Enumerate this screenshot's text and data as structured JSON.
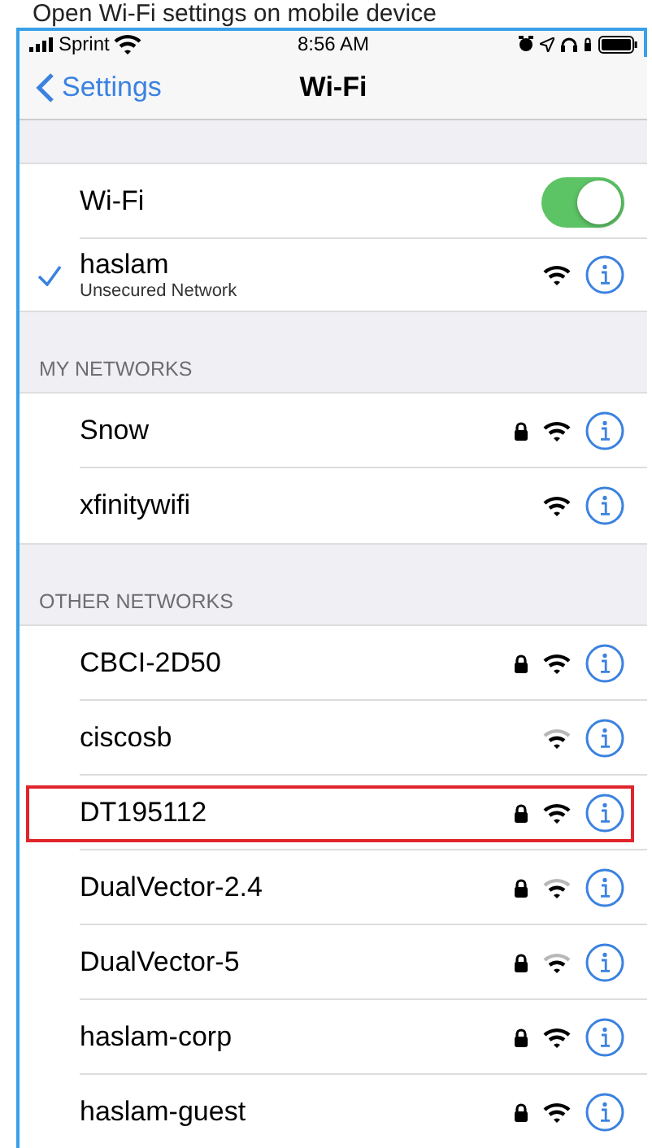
{
  "caption": "Open Wi-Fi settings on mobile device",
  "status_bar": {
    "carrier": "Sprint",
    "time": "8:56 AM"
  },
  "nav": {
    "back": "Settings",
    "title": "Wi-Fi"
  },
  "wifi_toggle": {
    "label": "Wi-Fi",
    "on": true
  },
  "current_network": {
    "name": "haslam",
    "subtitle": "Unsecured Network",
    "connected": true,
    "locked": false,
    "weak_signal": false
  },
  "sections": [
    {
      "header": "MY NETWORKS",
      "networks": [
        {
          "name": "Snow",
          "locked": true,
          "weak_signal": false,
          "highlighted": false
        },
        {
          "name": "xfinitywifi",
          "locked": false,
          "weak_signal": false,
          "highlighted": false
        }
      ]
    },
    {
      "header": "OTHER NETWORKS",
      "networks": [
        {
          "name": "CBCI-2D50",
          "locked": true,
          "weak_signal": false,
          "highlighted": false
        },
        {
          "name": "ciscosb",
          "locked": false,
          "weak_signal": true,
          "highlighted": false
        },
        {
          "name": "DT195112",
          "locked": true,
          "weak_signal": false,
          "highlighted": true
        },
        {
          "name": "DualVector-2.4",
          "locked": true,
          "weak_signal": true,
          "highlighted": false
        },
        {
          "name": "DualVector-5",
          "locked": true,
          "weak_signal": true,
          "highlighted": false
        },
        {
          "name": "haslam-corp",
          "locked": true,
          "weak_signal": false,
          "highlighted": false
        },
        {
          "name": "haslam-guest",
          "locked": true,
          "weak_signal": false,
          "highlighted": false
        }
      ]
    }
  ]
}
